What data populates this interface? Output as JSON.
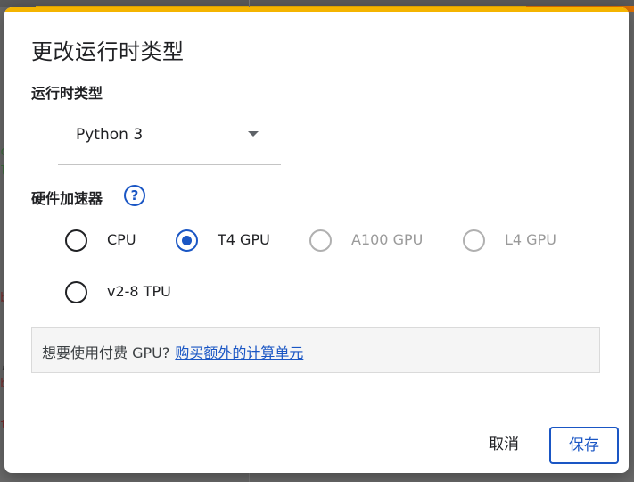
{
  "background": {
    "accent_colors": [
      "#f4b400",
      "#e37400"
    ],
    "code_fragments": [
      "c",
      "l",
      "b",
      ",",
      "b",
      "t"
    ]
  },
  "dialog": {
    "title": "更改运行时类型",
    "runtime_section": {
      "label": "运行时类型",
      "selected_value": "Python 3"
    },
    "hardware_section": {
      "label": "硬件加速器",
      "help_icon_glyph": "?",
      "options": [
        {
          "label": "CPU",
          "checked": false,
          "disabled": false
        },
        {
          "label": "T4 GPU",
          "checked": true,
          "disabled": false
        },
        {
          "label": "A100 GPU",
          "checked": false,
          "disabled": true
        },
        {
          "label": "L4 GPU",
          "checked": false,
          "disabled": true
        },
        {
          "label": "v2-8 TPU",
          "checked": false,
          "disabled": false
        }
      ]
    },
    "notice": {
      "text": "想要使用付费 GPU?",
      "link": "购买额外的计算单元"
    },
    "buttons": {
      "cancel": "取消",
      "save": "保存"
    }
  },
  "colors": {
    "primary": "#1a56c4",
    "disabled": "#9a9a9a"
  }
}
